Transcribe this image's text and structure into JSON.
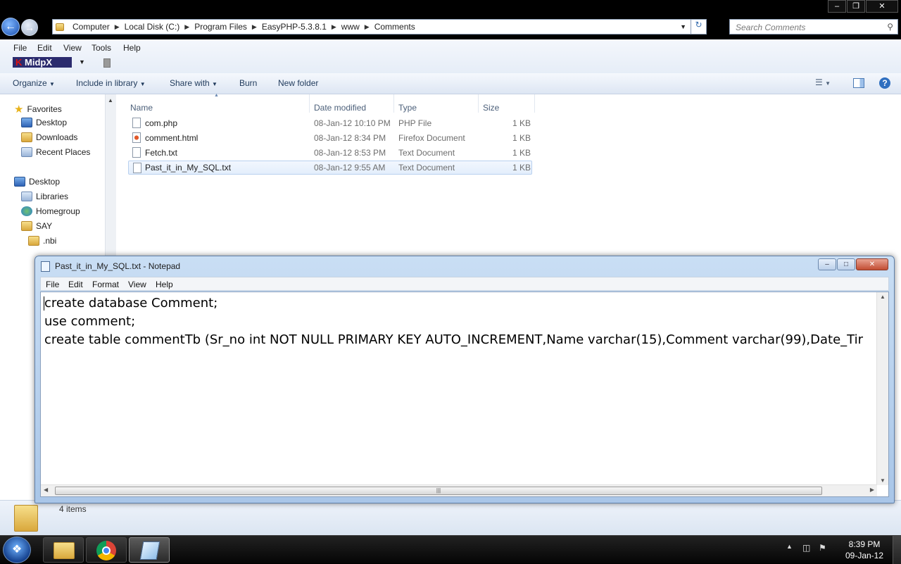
{
  "explorer": {
    "breadcrumbs": [
      "Computer",
      "Local Disk (C:)",
      "Program Files",
      "EasyPHP-5.3.8.1",
      "www",
      "Comments"
    ],
    "search_placeholder": "Search Comments",
    "menu": [
      "File",
      "Edit",
      "View",
      "Tools",
      "Help"
    ],
    "toolbar_brand": "MidpX",
    "commands": [
      "Organize",
      "Include in library",
      "Share with",
      "Burn",
      "New folder"
    ],
    "nav": {
      "favorites_label": "Favorites",
      "favorites": [
        "Desktop",
        "Downloads",
        "Recent Places"
      ],
      "desktop_label": "Desktop",
      "tree": [
        "Libraries",
        "Homegroup",
        "SAY",
        ".nbi"
      ]
    },
    "columns": {
      "name": "Name",
      "date": "Date modified",
      "type": "Type",
      "size": "Size"
    },
    "files": [
      {
        "name": "com.php",
        "date": "08-Jan-12 10:10 PM",
        "type": "PHP File",
        "size": "1 KB"
      },
      {
        "name": "comment.html",
        "date": "08-Jan-12 8:34 PM",
        "type": "Firefox Document",
        "size": "1 KB"
      },
      {
        "name": "Fetch.txt",
        "date": "08-Jan-12 8:53 PM",
        "type": "Text Document",
        "size": "1 KB"
      },
      {
        "name": "Past_it_in_My_SQL.txt",
        "date": "08-Jan-12 9:55 AM",
        "type": "Text Document",
        "size": "1 KB"
      }
    ],
    "status": "4 items"
  },
  "notepad": {
    "title": "Past_it_in_My_SQL.txt - Notepad",
    "menu": [
      "File",
      "Edit",
      "Format",
      "View",
      "Help"
    ],
    "lines": [
      "create database Comment;",
      "use comment;",
      "create table commentTb (Sr_no int NOT NULL PRIMARY KEY AUTO_INCREMENT,Name varchar(15),Comment varchar(99),Date_Tir"
    ]
  },
  "taskbar": {
    "time": "8:39 PM",
    "date": "09-Jan-12"
  }
}
